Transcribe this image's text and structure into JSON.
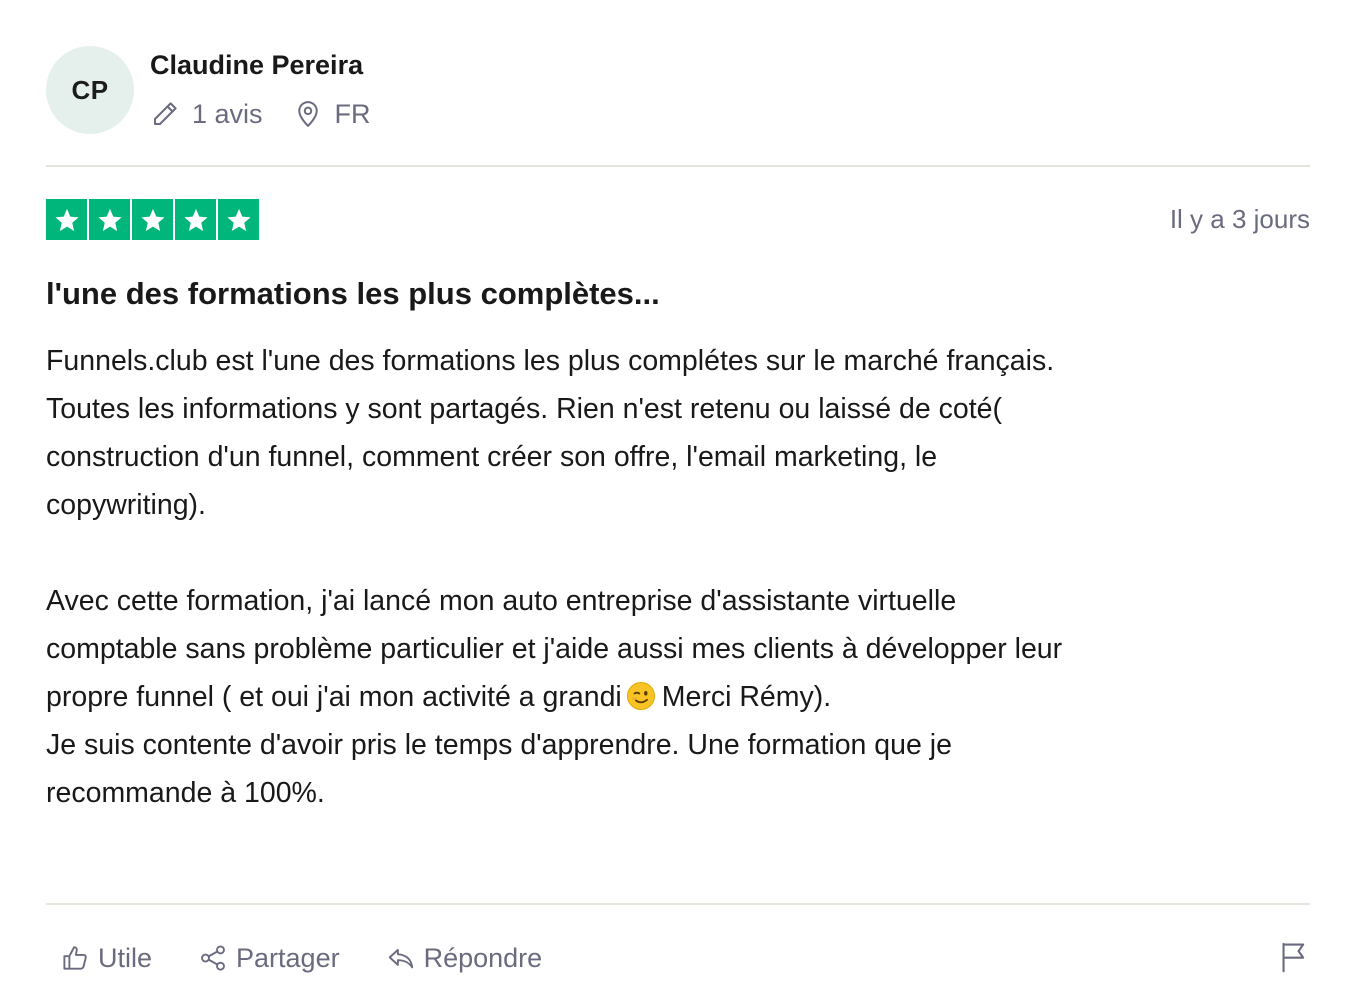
{
  "reviewer": {
    "initials": "CP",
    "name": "Claudine Pereira",
    "review_count": "1 avis",
    "country": "FR",
    "avatar_color": "#e5f0ec"
  },
  "review": {
    "rating": 5,
    "rating_max": 5,
    "star_color": "#00b67a",
    "date": "Il y a 3 jours",
    "title": "l'une des formations les plus complètes...",
    "body": {
      "line1": "Funnels.club est l'une des formations les plus complétes sur le marché français.",
      "line2": "Toutes les informations y sont partagés. Rien n'est retenu ou laissé de coté(",
      "line3": "construction d'un funnel, comment créer son offre, l'email marketing, le",
      "line4": "copywriting).",
      "line5": "Avec cette formation, j'ai lancé mon auto entreprise d'assistante virtuelle",
      "line6": "comptable sans problème particulier et j'aide aussi mes clients à développer leur",
      "line7_before_emoji": "propre funnel ( et oui j'ai mon activité a grandi",
      "line7_after_emoji": "Merci Rémy).",
      "line8": "Je suis contente d'avoir pris le temps d'apprendre. Une formation que je",
      "line9": "recommande à 100%."
    },
    "emoji": "winking-face-emoji"
  },
  "actions": {
    "useful_label": "Utile",
    "share_label": "Partager",
    "reply_label": "Répondre"
  },
  "icons": {
    "pencil": "pencil-icon",
    "location": "location-pin-icon",
    "thumbs_up": "thumbs-up-icon",
    "share": "share-icon",
    "reply": "reply-icon",
    "flag": "flag-icon"
  }
}
